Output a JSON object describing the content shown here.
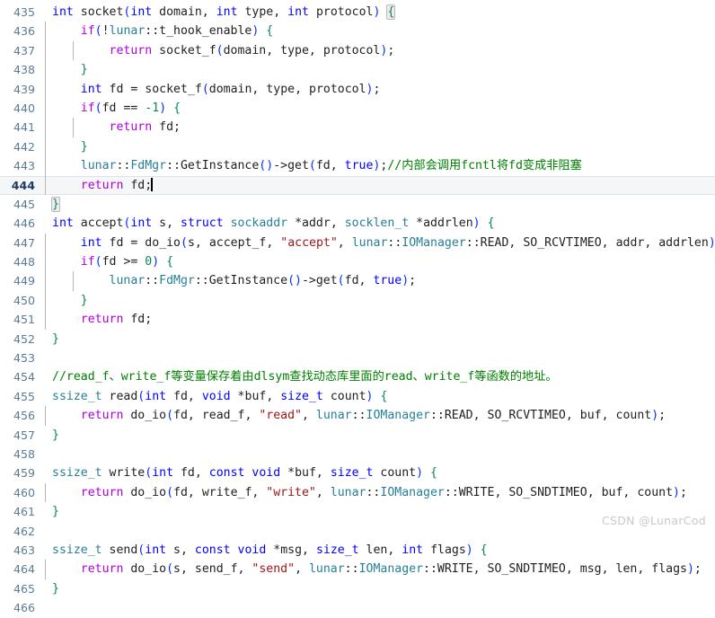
{
  "editor": {
    "language": "cpp",
    "first_line": 435,
    "last_line": 466,
    "current_line": 444,
    "colors": {
      "background": "#ffffff",
      "gutter_text": "#5c7b96",
      "current_line_bg": "#f4f6f8",
      "keyword": "#0000ff",
      "control": "#af00db",
      "type_namespace": "#267f99",
      "string": "#a31515",
      "number": "#098658",
      "comment": "#008000",
      "identifier": "#1f1f1f",
      "watermark": "#c9c9c9"
    }
  },
  "lines": [
    {
      "n": "435",
      "text": "int socket(int domain, int type, int protocol) {"
    },
    {
      "n": "436",
      "text": "    if(!lunar::t_hook_enable) {"
    },
    {
      "n": "437",
      "text": "        return socket_f(domain, type, protocol);"
    },
    {
      "n": "438",
      "text": "    }"
    },
    {
      "n": "439",
      "text": "    int fd = socket_f(domain, type, protocol);"
    },
    {
      "n": "440",
      "text": "    if(fd == -1) {"
    },
    {
      "n": "441",
      "text": "        return fd;"
    },
    {
      "n": "442",
      "text": "    }"
    },
    {
      "n": "443",
      "text": "    lunar::FdMgr::GetInstance()->get(fd, true);//内部会调用fcntl将fd变成非阻塞"
    },
    {
      "n": "444",
      "text": "    return fd;"
    },
    {
      "n": "445",
      "text": "}"
    },
    {
      "n": "446",
      "text": "int accept(int s, struct sockaddr *addr, socklen_t *addrlen) {"
    },
    {
      "n": "447",
      "text": "    int fd = do_io(s, accept_f, \"accept\", lunar::IOManager::READ, SO_RCVTIMEO, addr, addrlen);"
    },
    {
      "n": "448",
      "text": "    if(fd >= 0) {"
    },
    {
      "n": "449",
      "text": "        lunar::FdMgr::GetInstance()->get(fd, true);"
    },
    {
      "n": "450",
      "text": "    }"
    },
    {
      "n": "451",
      "text": "    return fd;"
    },
    {
      "n": "452",
      "text": "}"
    },
    {
      "n": "453",
      "text": ""
    },
    {
      "n": "454",
      "text": "//read_f、write_f等变量保存着由dlsym查找动态库里面的read、write_f等函数的地址。"
    },
    {
      "n": "455",
      "text": "ssize_t read(int fd, void *buf, size_t count) {"
    },
    {
      "n": "456",
      "text": "    return do_io(fd, read_f, \"read\", lunar::IOManager::READ, SO_RCVTIMEO, buf, count);"
    },
    {
      "n": "457",
      "text": "}"
    },
    {
      "n": "458",
      "text": ""
    },
    {
      "n": "459",
      "text": "ssize_t write(int fd, const void *buf, size_t count) {"
    },
    {
      "n": "460",
      "text": "    return do_io(fd, write_f, \"write\", lunar::IOManager::WRITE, SO_SNDTIMEO, buf, count);"
    },
    {
      "n": "461",
      "text": "}"
    },
    {
      "n": "462",
      "text": ""
    },
    {
      "n": "463",
      "text": "ssize_t send(int s, const void *msg, size_t len, int flags) {"
    },
    {
      "n": "464",
      "text": "    return do_io(s, send_f, \"send\", lunar::IOManager::WRITE, SO_SNDTIMEO, msg, len, flags);"
    },
    {
      "n": "465",
      "text": "}"
    },
    {
      "n": "466",
      "text": ""
    }
  ],
  "watermark": {
    "text": "CSDN @LunarCod"
  }
}
